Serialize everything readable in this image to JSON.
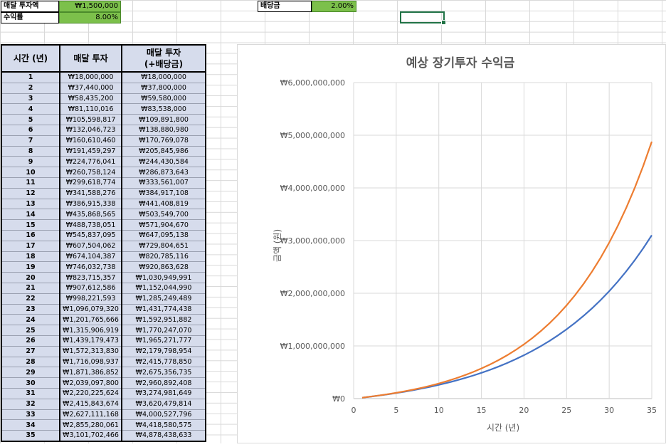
{
  "top": {
    "monthly_label": "매달 투자액",
    "monthly_value": "₩1,500,000",
    "rate_label": "수익률",
    "rate_value": "8.00%",
    "dividend_label": "배당금",
    "dividend_value": "2.00%"
  },
  "table": {
    "headers": [
      "시간 (년)",
      "매달 투자",
      "매달 투자\n(+배당금)"
    ],
    "rows": [
      [
        "1",
        "₩18,000,000",
        "₩18,000,000"
      ],
      [
        "2",
        "₩37,440,000",
        "₩37,800,000"
      ],
      [
        "3",
        "₩58,435,200",
        "₩59,580,000"
      ],
      [
        "4",
        "₩81,110,016",
        "₩83,538,000"
      ],
      [
        "5",
        "₩105,598,817",
        "₩109,891,800"
      ],
      [
        "6",
        "₩132,046,723",
        "₩138,880,980"
      ],
      [
        "7",
        "₩160,610,460",
        "₩170,769,078"
      ],
      [
        "8",
        "₩191,459,297",
        "₩205,845,986"
      ],
      [
        "9",
        "₩224,776,041",
        "₩244,430,584"
      ],
      [
        "10",
        "₩260,758,124",
        "₩286,873,643"
      ],
      [
        "11",
        "₩299,618,774",
        "₩333,561,007"
      ],
      [
        "12",
        "₩341,588,276",
        "₩384,917,108"
      ],
      [
        "13",
        "₩386,915,338",
        "₩441,408,819"
      ],
      [
        "14",
        "₩435,868,565",
        "₩503,549,700"
      ],
      [
        "15",
        "₩488,738,051",
        "₩571,904,670"
      ],
      [
        "16",
        "₩545,837,095",
        "₩647,095,138"
      ],
      [
        "17",
        "₩607,504,062",
        "₩729,804,651"
      ],
      [
        "18",
        "₩674,104,387",
        "₩820,785,116"
      ],
      [
        "19",
        "₩746,032,738",
        "₩920,863,628"
      ],
      [
        "20",
        "₩823,715,357",
        "₩1,030,949,991"
      ],
      [
        "21",
        "₩907,612,586",
        "₩1,152,044,990"
      ],
      [
        "22",
        "₩998,221,593",
        "₩1,285,249,489"
      ],
      [
        "23",
        "₩1,096,079,320",
        "₩1,431,774,438"
      ],
      [
        "24",
        "₩1,201,765,666",
        "₩1,592,951,882"
      ],
      [
        "25",
        "₩1,315,906,919",
        "₩1,770,247,070"
      ],
      [
        "26",
        "₩1,439,179,473",
        "₩1,965,271,777"
      ],
      [
        "27",
        "₩1,572,313,830",
        "₩2,179,798,954"
      ],
      [
        "28",
        "₩1,716,098,937",
        "₩2,415,778,850"
      ],
      [
        "29",
        "₩1,871,386,852",
        "₩2,675,356,735"
      ],
      [
        "30",
        "₩2,039,097,800",
        "₩2,960,892,408"
      ],
      [
        "31",
        "₩2,220,225,624",
        "₩3,274,981,649"
      ],
      [
        "32",
        "₩2,415,843,674",
        "₩3,620,479,814"
      ],
      [
        "33",
        "₩2,627,111,168",
        "₩4,000,527,796"
      ],
      [
        "34",
        "₩2,855,280,061",
        "₩4,418,580,575"
      ],
      [
        "35",
        "₩3,101,702,466",
        "₩4,878,438,633"
      ]
    ]
  },
  "chart_data": {
    "type": "line",
    "title": "예상 장기투자 수익금",
    "xlabel": "시간 (년)",
    "ylabel": "금액 (원)",
    "xlim": [
      0,
      35
    ],
    "ylim": [
      0,
      6000000000
    ],
    "x_ticks": [
      "0",
      "5",
      "10",
      "15",
      "20",
      "25",
      "30",
      "35"
    ],
    "y_ticks": [
      "₩0",
      "₩1,000,000,000",
      "₩2,000,000,000",
      "₩3,000,000,000",
      "₩4,000,000,000",
      "₩5,000,000,000",
      "₩6,000,000,000"
    ],
    "grid": true,
    "x": [
      1,
      2,
      3,
      4,
      5,
      6,
      7,
      8,
      9,
      10,
      11,
      12,
      13,
      14,
      15,
      16,
      17,
      18,
      19,
      20,
      21,
      22,
      23,
      24,
      25,
      26,
      27,
      28,
      29,
      30,
      31,
      32,
      33,
      34,
      35
    ],
    "series": [
      {
        "values": [
          18000000,
          37440000,
          58435200,
          81110016,
          105598817,
          132046723,
          160610460,
          191459297,
          224776041,
          260758124,
          299618774,
          341588276,
          386915338,
          435868565,
          488738051,
          545837095,
          607504062,
          674104387,
          746032738,
          823715357,
          907612586,
          998221593,
          1096079320,
          1201765666,
          1315906919,
          1439179473,
          1572313830,
          1716098937,
          1871386852,
          2039097800,
          2220225624,
          2415843674,
          2627111168,
          2855280061,
          3101702466
        ]
      },
      {
        "values": [
          18000000,
          37800000,
          59580000,
          83538000,
          109891800,
          138880980,
          170769078,
          205845986,
          244430584,
          286873643,
          333561007,
          384917108,
          441408819,
          503549700,
          571904670,
          647095138,
          729804651,
          820785116,
          920863628,
          1030949991,
          1152044990,
          1285249489,
          1431774438,
          1592951882,
          1770247070,
          1965271777,
          2179798954,
          2415778850,
          2675356735,
          2960892408,
          3274981649,
          3620479814,
          4000527796,
          4418580575,
          4878438633
        ]
      }
    ],
    "colors": [
      "#4472c4",
      "#ed7d31"
    ]
  }
}
